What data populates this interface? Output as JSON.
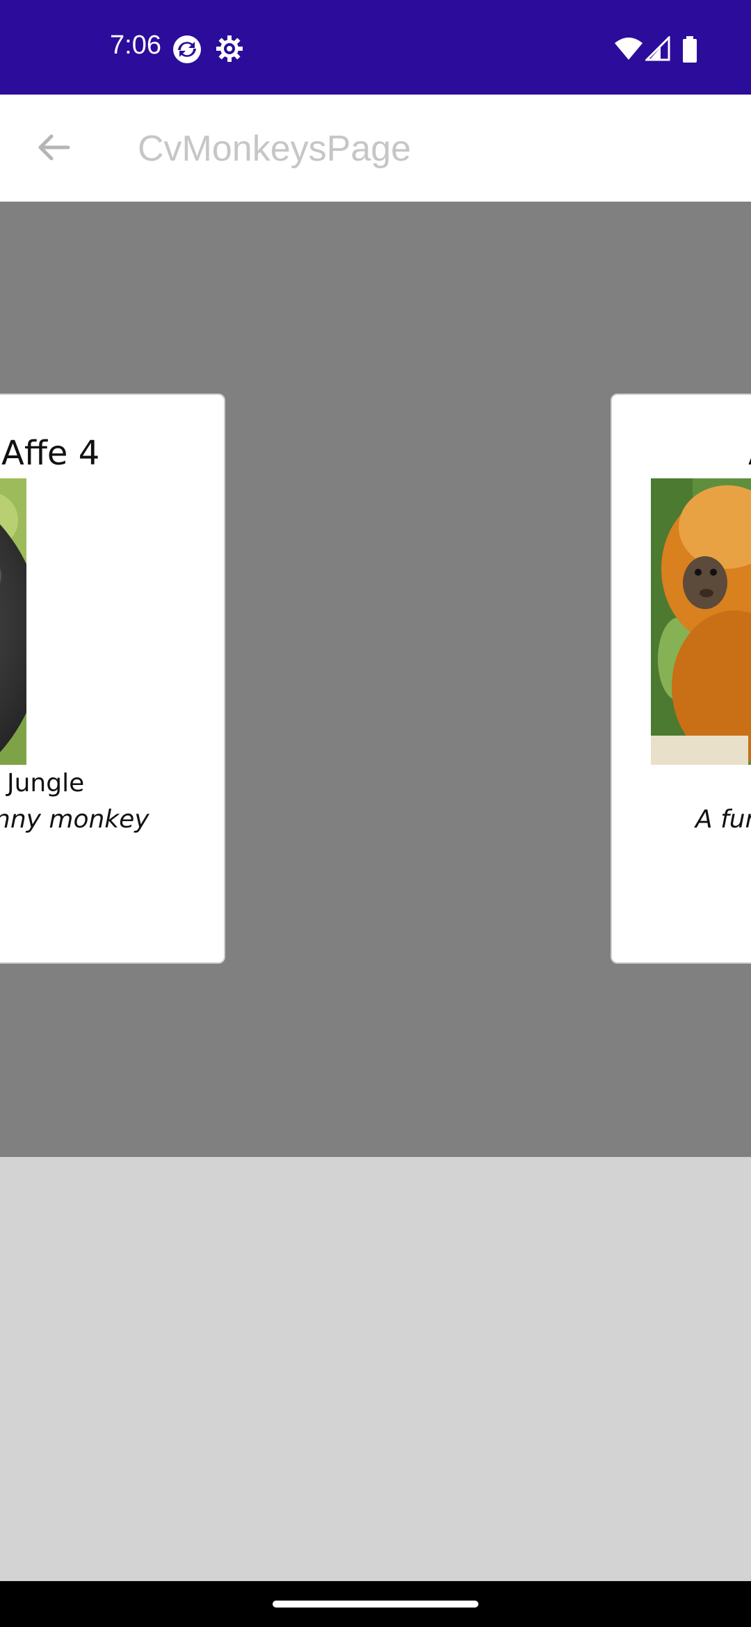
{
  "status_bar": {
    "time": "7:06",
    "icons": [
      "sync-icon",
      "settings-icon",
      "wifi-icon",
      "signal-icon",
      "battery-icon"
    ]
  },
  "app_bar": {
    "title": "CvMonkeysPage",
    "back_icon": "arrow-back-icon"
  },
  "cards": [
    {
      "title": "Affe 4",
      "location": "Jungle",
      "details": "nny monkey",
      "image": "macaque-photo"
    },
    {
      "title": "A",
      "location": "",
      "details": "A fur",
      "image": "golden-lion-tamarin-photo"
    }
  ],
  "colors": {
    "status_bar": "#2c0c9b",
    "carousel_bg": "#808080",
    "page_bg": "#d3d3d3"
  }
}
